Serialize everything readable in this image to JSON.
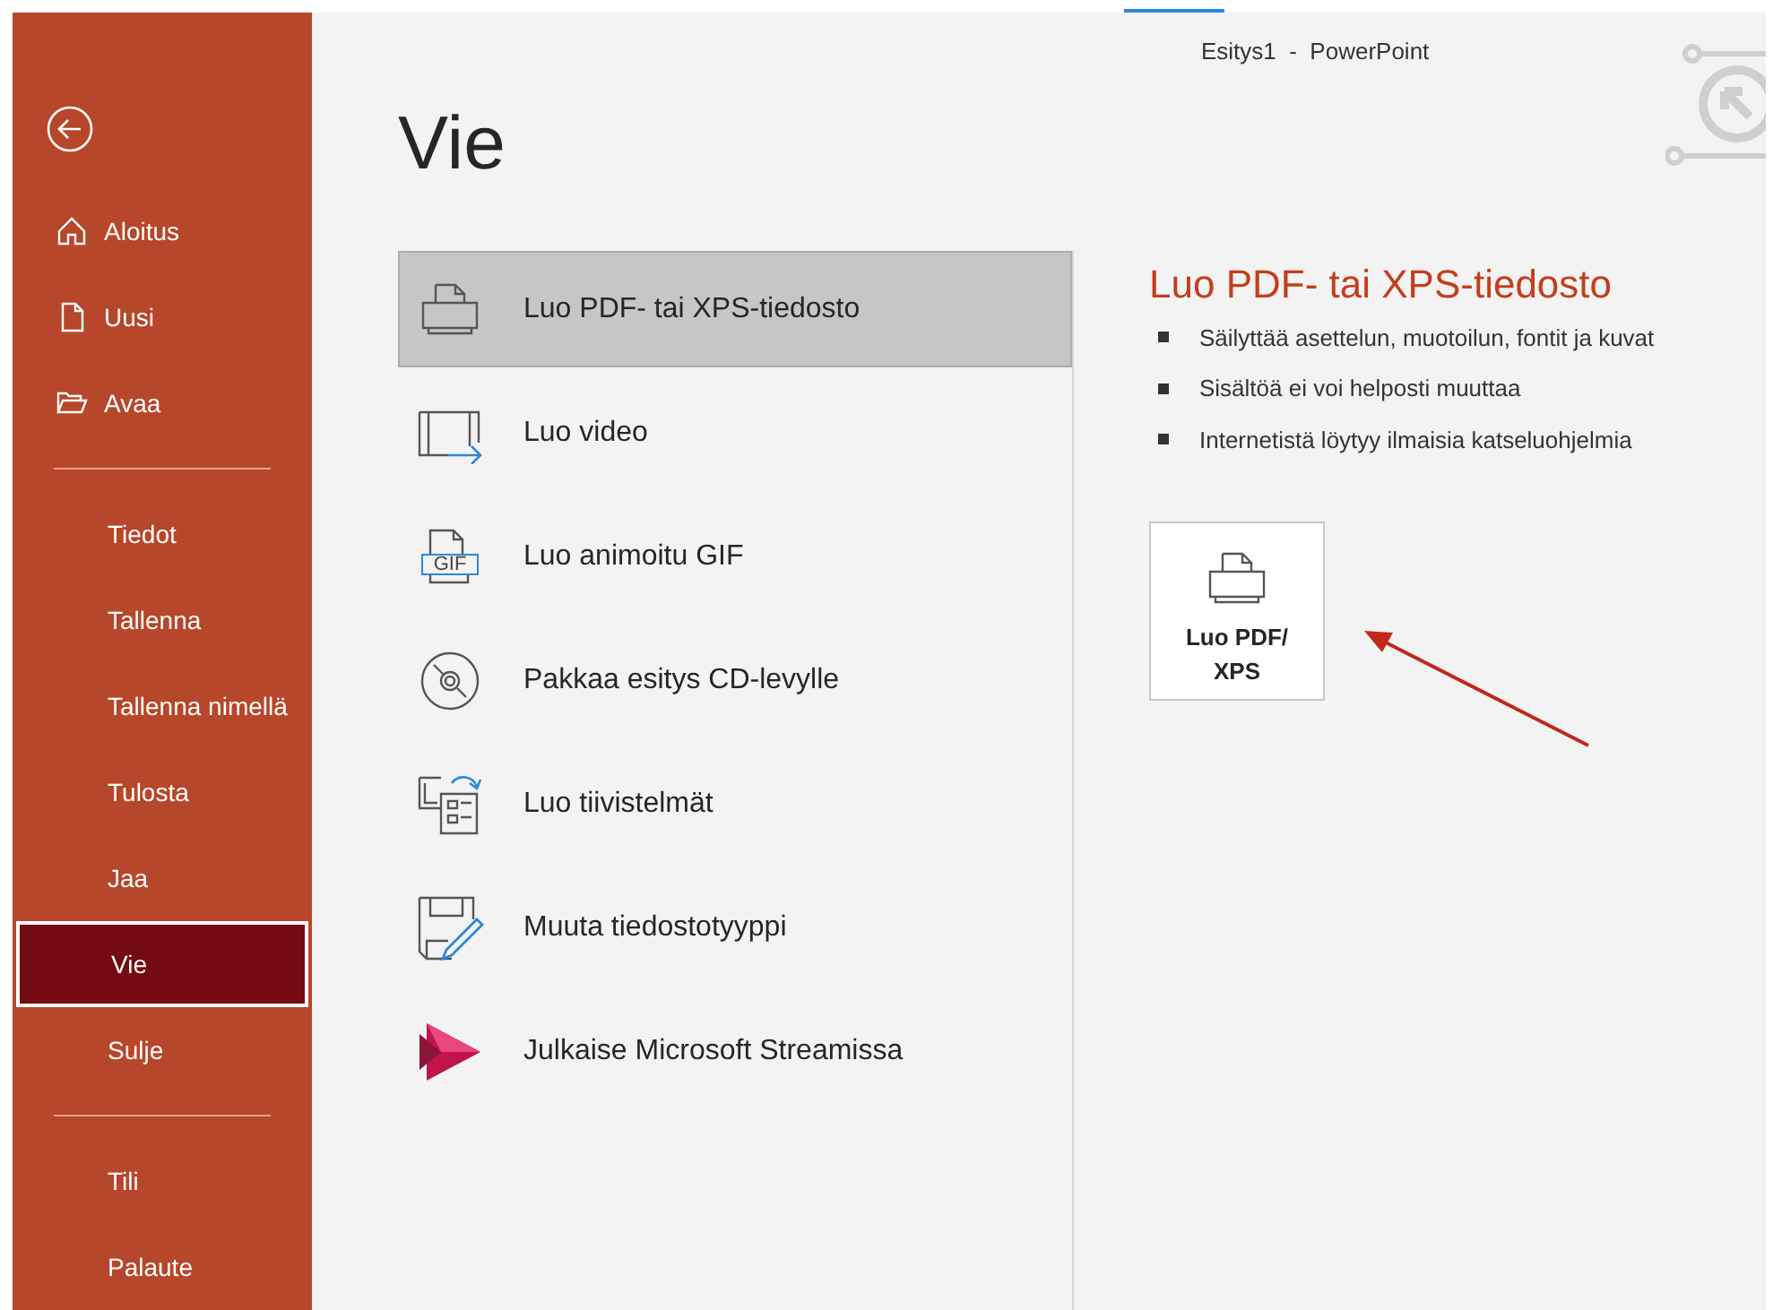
{
  "window": {
    "title": "Esitys1  -  PowerPoint"
  },
  "sidebar": {
    "groups": [
      {
        "items": [
          {
            "label": "Aloitus",
            "kind": "home",
            "selected": false
          },
          {
            "label": "Uusi",
            "kind": "new",
            "selected": false
          },
          {
            "label": "Avaa",
            "kind": "open",
            "selected": false
          }
        ]
      },
      {
        "items": [
          {
            "label": "Tiedot",
            "kind": "plain",
            "selected": false
          },
          {
            "label": "Tallenna",
            "kind": "plain",
            "selected": false
          },
          {
            "label": "Tallenna nimellä",
            "kind": "plain",
            "selected": false
          },
          {
            "label": "Tulosta",
            "kind": "plain",
            "selected": false
          },
          {
            "label": "Jaa",
            "kind": "plain",
            "selected": false
          },
          {
            "label": "Vie",
            "kind": "plain",
            "selected": true
          },
          {
            "label": "Sulje",
            "kind": "plain",
            "selected": false
          }
        ]
      },
      {
        "items": [
          {
            "label": "Tili",
            "kind": "plain",
            "selected": false
          },
          {
            "label": "Palaute",
            "kind": "plain",
            "selected": false
          }
        ]
      }
    ]
  },
  "page_title": "Vie",
  "options": [
    {
      "label": "Luo PDF- tai XPS-tiedosto",
      "kind": "pdf",
      "selected": true
    },
    {
      "label": "Luo video",
      "kind": "video",
      "selected": false
    },
    {
      "label": "Luo animoitu GIF",
      "kind": "gif",
      "selected": false,
      "icon_text": "GIF"
    },
    {
      "label": "Pakkaa esitys CD-levylle",
      "kind": "cd",
      "selected": false
    },
    {
      "label": "Luo tiivistelmät",
      "kind": "handouts",
      "selected": false
    },
    {
      "label": "Muuta tiedostotyyppi",
      "kind": "filetype",
      "selected": false
    },
    {
      "label": "Julkaise Microsoft Streamissa",
      "kind": "stream",
      "selected": false
    }
  ],
  "detail": {
    "heading": "Luo PDF- tai XPS-tiedosto",
    "bullets": [
      "Säilyttää asettelun, muotoilun, fontit ja kuvat",
      "Sisältöä ei voi helposti muuttaa",
      "Internetistä löytyy ilmaisia katseluohjelmia"
    ],
    "button_lines": [
      "Luo PDF/",
      "XPS"
    ]
  }
}
